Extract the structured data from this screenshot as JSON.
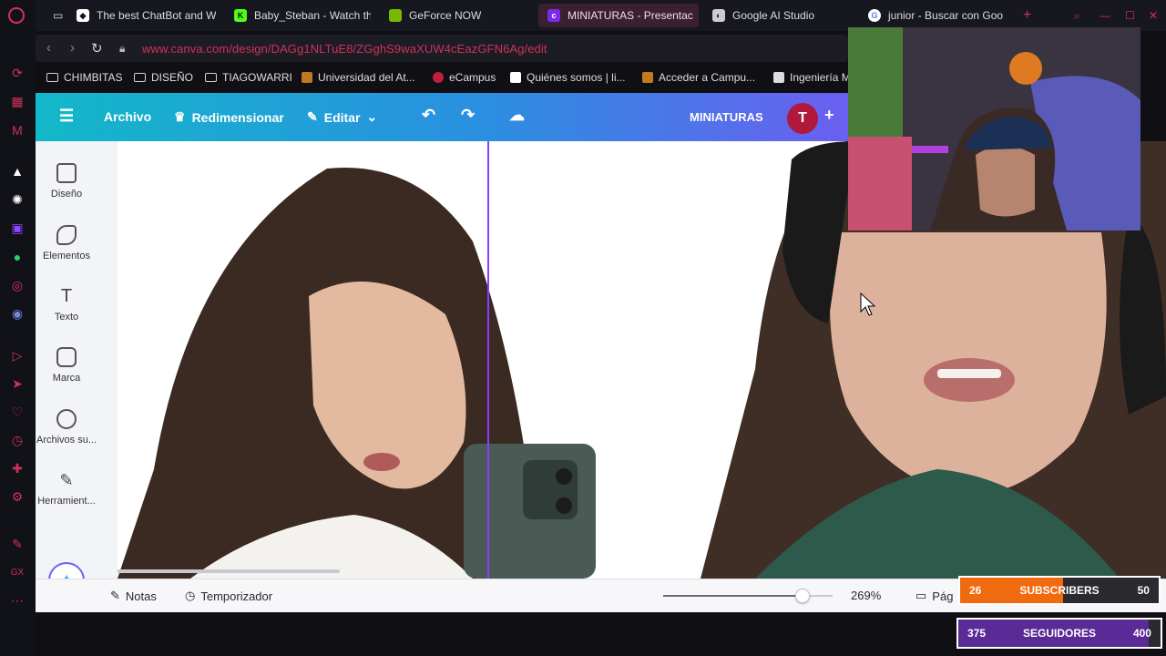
{
  "browser": {
    "tabs": [
      {
        "title": "The best ChatBot and W",
        "icon": "chatbot-icon",
        "color": "#ffffff"
      },
      {
        "title": "Baby_Steban - Watch th",
        "icon": "kick-icon",
        "color": "#53fc18"
      },
      {
        "title": "GeForce NOW",
        "icon": "nvidia-icon",
        "color": "#76b900"
      },
      {
        "title": "MINIATURAS - Presentac",
        "icon": "canva-icon",
        "color": "#7d2ae8"
      },
      {
        "title": "Google AI Studio",
        "icon": "ai-studio-icon",
        "color": "#cccccc"
      },
      {
        "title": "junior - Buscar con Goo",
        "icon": "google-icon",
        "color": "#4285f4"
      }
    ],
    "new_tab_label": "+",
    "url": "www.canva.com/design/DAGg1NLTuE8/ZGghS9waXUW4cEazGFN6Ag/edit",
    "bookmarks": [
      {
        "label": "CHIMBITAS",
        "type": "folder"
      },
      {
        "label": "DISEÑO",
        "type": "folder"
      },
      {
        "label": "TIAGOWARRI",
        "type": "folder"
      },
      {
        "label": "Universidad del At...",
        "type": "site"
      },
      {
        "label": "eCampus",
        "type": "site"
      },
      {
        "label": "Quiénes somos | li...",
        "type": "site"
      },
      {
        "label": "Acceder a Campu...",
        "type": "site"
      },
      {
        "label": "Ingeniería M",
        "type": "site"
      }
    ]
  },
  "canva": {
    "menu": {
      "file": "Archivo",
      "resize": "Redimensionar",
      "edit": "Editar"
    },
    "design_title": "MINIATURAS",
    "avatar_letter": "T",
    "left_panel": [
      {
        "label": "Diseño",
        "icon": "layout-icon"
      },
      {
        "label": "Elementos",
        "icon": "elements-icon"
      },
      {
        "label": "Texto",
        "icon": "text-icon"
      },
      {
        "label": "Marca",
        "icon": "brand-icon"
      },
      {
        "label": "Archivos su...",
        "icon": "uploads-icon"
      },
      {
        "label": "Herramient...",
        "icon": "tools-icon"
      }
    ],
    "bottom": {
      "notes": "Notas",
      "timer": "Temporizador",
      "zoom": "269%",
      "zoom_fraction": 0.82,
      "pages": "Pág"
    }
  },
  "stream": {
    "subscribers": {
      "current": "26",
      "label": "SUBSCRIBERS",
      "goal": "50",
      "progress": 0.52,
      "color": "#f06a0f"
    },
    "followers": {
      "current": "375",
      "label": "SEGUIDORES",
      "goal": "400",
      "progress": 0.94,
      "color": "#5a2a96"
    }
  }
}
